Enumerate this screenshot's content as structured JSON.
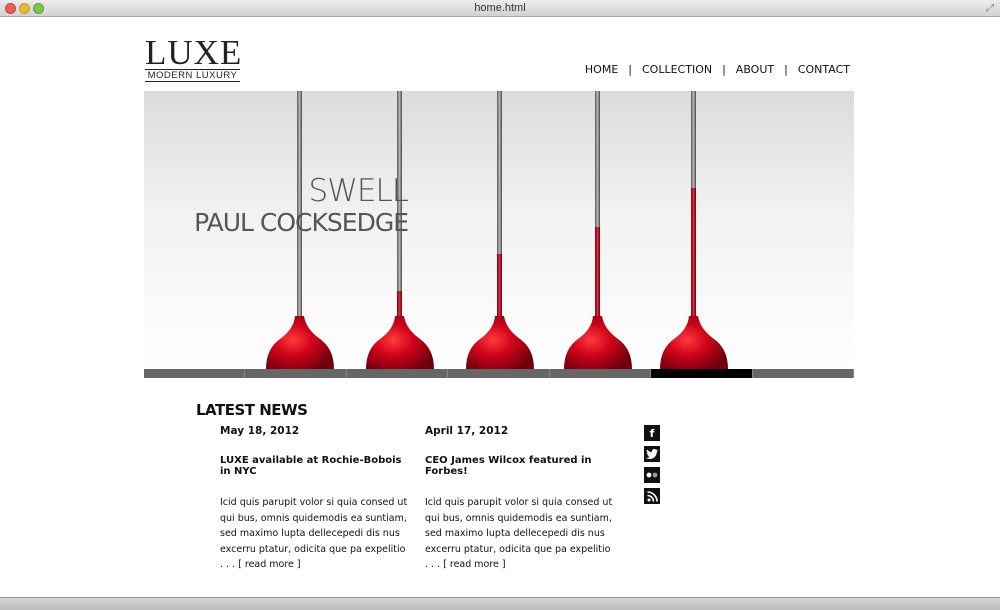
{
  "window": {
    "title": "home.html"
  },
  "logo": {
    "main": "LUXE",
    "sub": "MODERN LUXURY"
  },
  "nav": {
    "items": [
      {
        "label": "HOME"
      },
      {
        "label": "COLLECTION"
      },
      {
        "label": "ABOUT"
      },
      {
        "label": "CONTACT"
      }
    ]
  },
  "hero": {
    "line1": "SWELL",
    "line2": "PAUL COCKSEDGE"
  },
  "slider": {
    "segment_count": 7,
    "active_index": 5
  },
  "news": {
    "title": "LATEST NEWS",
    "articles": [
      {
        "date": "May 18, 2012",
        "headline": "LUXE available at Rochie-Bobois in NYC",
        "body": "Icid quis parupit volor si quia consed ut qui bus, omnis quidemodis ea suntiam, sed maximo lupta dellecepedi dis nus excerru ptatur, odicita que pa expelitio . . .",
        "more": "[ read more ]"
      },
      {
        "date": "April 17, 2012",
        "headline": "CEO James Wilcox featured in Forbes!",
        "body": "Icid quis parupit volor si quia consed ut qui bus, omnis quidemodis ea suntiam, sed maximo lupta dellecepedi dis nus excerru ptatur, odicita que pa expelitio . . .",
        "more": "[ read more ]"
      }
    ]
  },
  "social": {
    "icons": [
      "facebook-icon",
      "twitter-icon",
      "flickr-icon",
      "rss-icon"
    ]
  },
  "colors": {
    "accent": "#c4001a",
    "slider_active": "#000000",
    "slider_inactive": "#666666"
  }
}
